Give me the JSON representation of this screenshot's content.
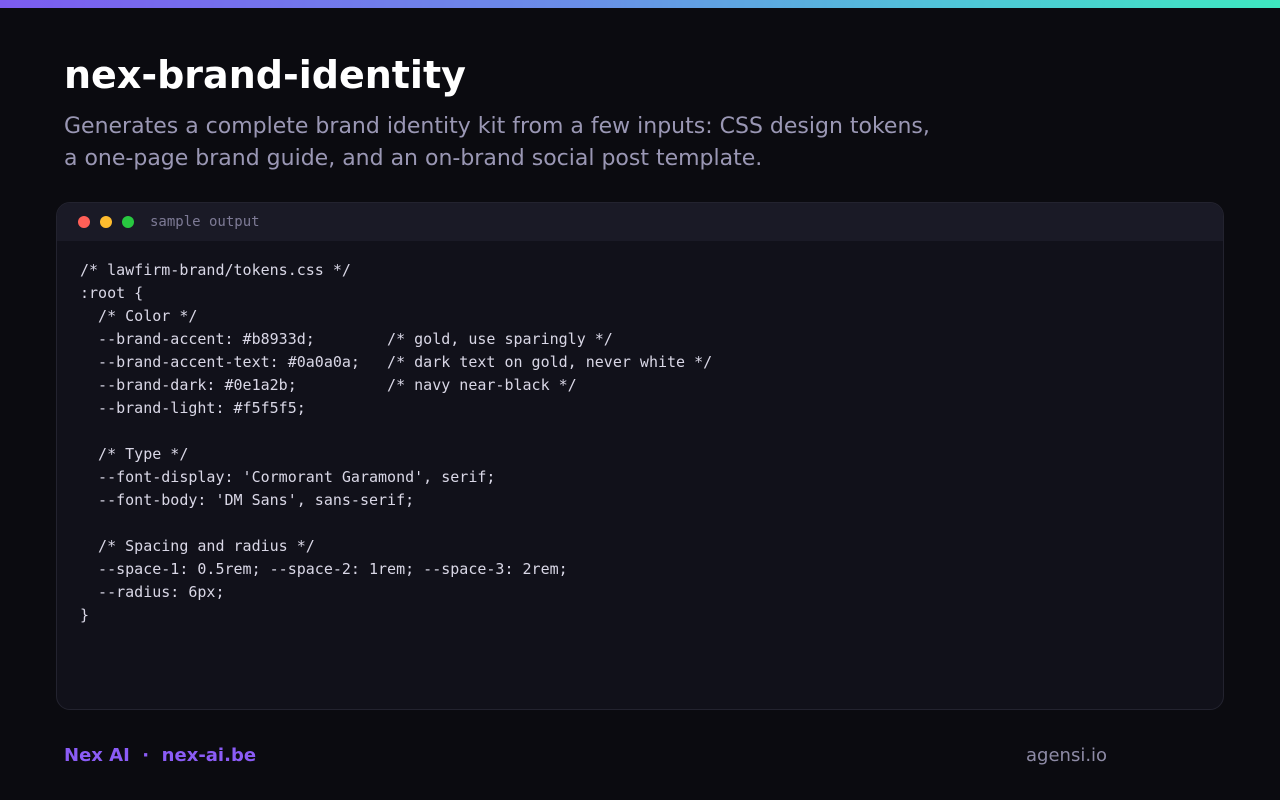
{
  "colors": {
    "background": "#0b0b10",
    "accent": "#8b5cf6",
    "gradient_start": "#7c5cf0",
    "gradient_end": "#3ee8c0",
    "window_bg": "#11111a",
    "window_header_bg": "#1a1a26",
    "dot_red": "#ff5f57",
    "dot_yellow": "#febc2e",
    "dot_green": "#28c840"
  },
  "header": {
    "title": "nex-brand-identity",
    "description": "Generates a complete brand identity kit from a few inputs: CSS design tokens, a one-page brand guide, and an on-brand social post template."
  },
  "window": {
    "label": "sample output",
    "lines": [
      "/* lawfirm-brand/tokens.css */",
      ":root {",
      "  /* Color */",
      "  --brand-accent: #b8933d;        /* gold, use sparingly */",
      "  --brand-accent-text: #0a0a0a;   /* dark text on gold, never white */",
      "  --brand-dark: #0e1a2b;          /* navy near-black */",
      "  --brand-light: #f5f5f5;",
      "",
      "  /* Type */",
      "  --font-display: 'Cormorant Garamond', serif;",
      "  --font-body: 'DM Sans', sans-serif;",
      "",
      "  /* Spacing and radius */",
      "  --space-1: 0.5rem; --space-2: 1rem; --space-3: 2rem;",
      "  --radius: 6px;",
      "}"
    ]
  },
  "footer": {
    "left": "Nex AI  ·  nex-ai.be",
    "right": "agensi.io"
  }
}
